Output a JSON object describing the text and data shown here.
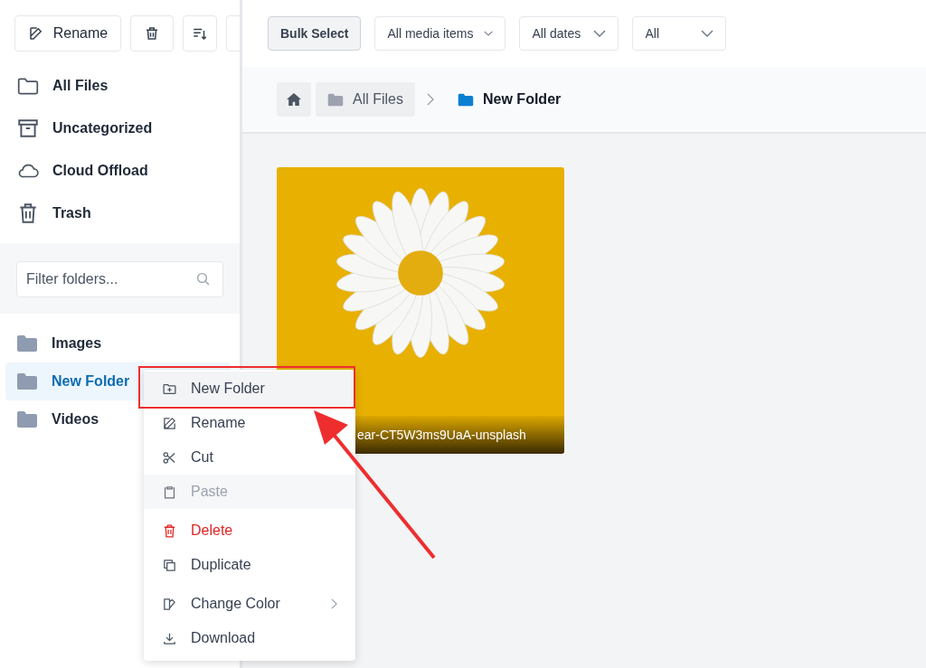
{
  "sidebar": {
    "toolbar": {
      "rename_label": "Rename"
    },
    "nav_items": [
      {
        "label": "All Files"
      },
      {
        "label": "Uncategorized"
      },
      {
        "label": "Cloud Offload"
      },
      {
        "label": "Trash"
      }
    ],
    "filter": {
      "placeholder": "Filter folders..."
    },
    "folders": [
      {
        "label": "Images",
        "selected": false
      },
      {
        "label": "New Folder",
        "selected": true
      },
      {
        "label": "Videos",
        "selected": false
      }
    ]
  },
  "toolbar": {
    "bulk_select": "Bulk Select",
    "dropdowns": [
      {
        "value": "All media items"
      },
      {
        "value": "All dates"
      },
      {
        "value": "All"
      }
    ]
  },
  "breadcrumb": {
    "items": [
      {
        "label": "All Files",
        "current": false
      },
      {
        "label": "New Folder",
        "current": true
      }
    ]
  },
  "files": [
    {
      "caption": "ear-CT5W3ms9UaA-unsplash"
    }
  ],
  "context_menu": [
    {
      "label": "New Folder",
      "kind": "action",
      "highlighted": true,
      "disabled": false
    },
    {
      "label": "Rename",
      "kind": "action",
      "highlighted": false,
      "disabled": false
    },
    {
      "label": "Cut",
      "kind": "action",
      "highlighted": false,
      "disabled": false
    },
    {
      "label": "Paste",
      "kind": "action",
      "highlighted": false,
      "disabled": true
    },
    {
      "label": "Delete",
      "kind": "danger",
      "highlighted": false,
      "disabled": false
    },
    {
      "label": "Duplicate",
      "kind": "action",
      "highlighted": false,
      "disabled": false
    },
    {
      "label": "Change Color",
      "kind": "submenu",
      "highlighted": false,
      "disabled": false
    },
    {
      "label": "Download",
      "kind": "action",
      "highlighted": false,
      "disabled": false
    }
  ]
}
